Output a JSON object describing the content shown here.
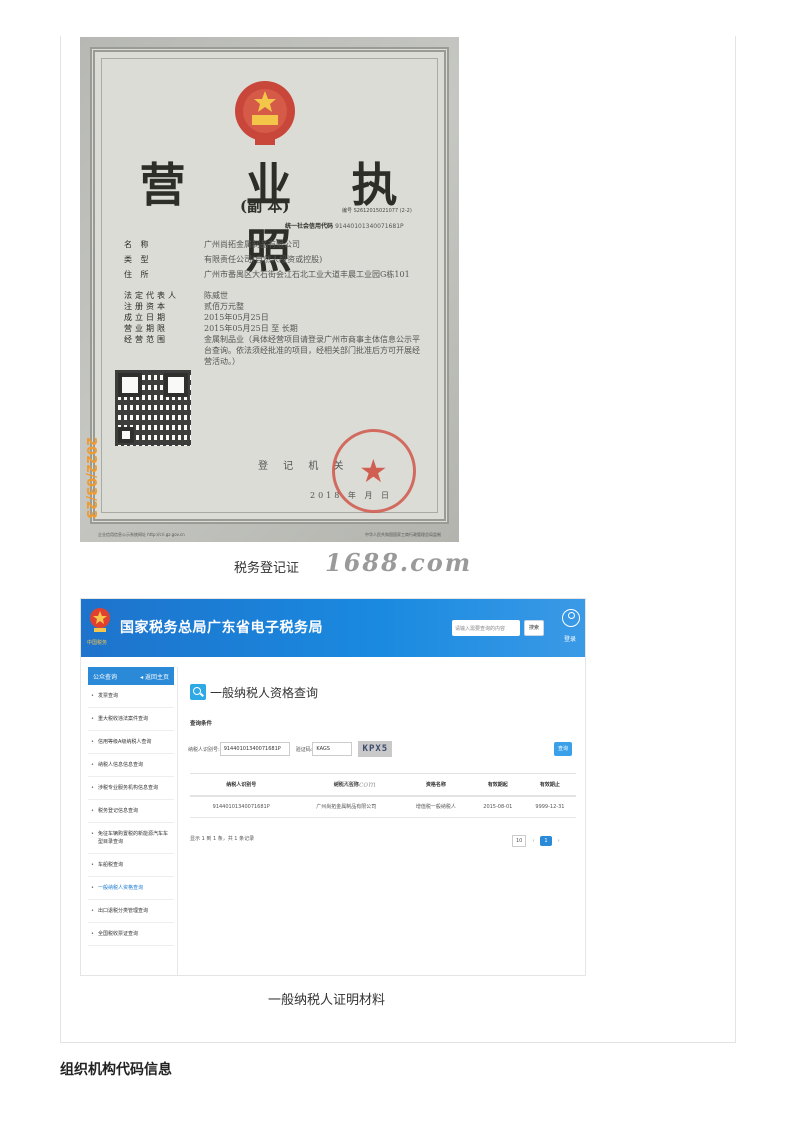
{
  "license": {
    "title": "营 业 执 照",
    "subtitle": "(副  本)",
    "reg_no": "编号 S2612015021077 (2-2)",
    "uscc_label": "统一社会信用代码",
    "uscc": "91440101340071681P",
    "rows": [
      {
        "k": "名        称",
        "v": "广州尚拓金属制品有限公司"
      },
      {
        "k": "类        型",
        "v": "有限责任公司(自然人投资或控股)"
      },
      {
        "k": "住        所",
        "v": "广州市番禺区大石街会江石北工业大道丰晨工业园G栋101"
      },
      {
        "k": "法定代表人",
        "v": "陈威世"
      },
      {
        "k": "注册资本",
        "v": "贰佰万元整"
      },
      {
        "k": "成立日期",
        "v": "2015年05月25日"
      },
      {
        "k": "营业期限",
        "v": "2015年05月25日 至 长期"
      },
      {
        "k": "经营范围",
        "v": "金属制品业（具体经营项目请登录广州市商事主体信息公示平台查询。依法须经批准的项目，经相关部门批准后方可开展经营活动。）"
      }
    ],
    "reg_authority": "登 记 机 关",
    "year": "2018  年  月  日",
    "date_stamp": "2022/03/23",
    "footer_left": "企业信用信息公示系统网址 http://cri.gz.gov.cn",
    "footer_right": "中华人民共和国国家工商行政管理总局监制"
  },
  "caption_license": "税务登记证",
  "watermark": "1688.com",
  "tax_portal": {
    "title": "国家税务总局广东省电子税务局",
    "logo_text": "中国税务",
    "search_placeholder": "请输入需要查询的内容",
    "search_button": "搜索",
    "login": "登录",
    "sidebar": {
      "head": "公众查询",
      "back": "◂ 返回主页",
      "items": [
        "发票查询",
        "重大税收违法案件查询",
        "信用等级A级纳税人查询",
        "纳税人信息信息查询",
        "涉税专业服务机构信息查询",
        "税务登记信息查询",
        "免征车辆购置税的新能源汽车车型目录查询",
        "车船税查询",
        "一般纳税人资格查询",
        "出口退税分类管理查询",
        "全国税收票证查询"
      ],
      "active_index": 8
    },
    "main": {
      "title": "一般纳税人资格查询",
      "conditions": "查询条件",
      "taxpayer_id_label": "纳税人识别号:",
      "taxpayer_id_value": "91440101340071681P",
      "captcha_label": "验证码:",
      "captcha_value": "KAGS",
      "captcha_image": "KPX5",
      "query_button": "查询",
      "columns": [
        "纳税人识别号",
        "纳税人名称",
        "资格名称",
        "有效期起",
        "有效期止"
      ],
      "rows": [
        [
          "91440101340071681P",
          "广州尚拓金属制品有限公司",
          "增值税一般纳税人",
          "2015-08-01",
          "9999-12-31"
        ]
      ],
      "table_watermark": "1688.com",
      "info": "显示 1 到 1 条，共 1 条记录",
      "page_size": "10",
      "page_prev": "‹",
      "page_current": "1",
      "page_next": "›"
    }
  },
  "caption_tax": "一般纳税人证明材料",
  "section_title": "组织机构代码信息",
  "colors": {
    "portal_blue": "#1e73cc",
    "stamp_red": "#cf4a3c",
    "date_orange": "#f19a2e"
  }
}
